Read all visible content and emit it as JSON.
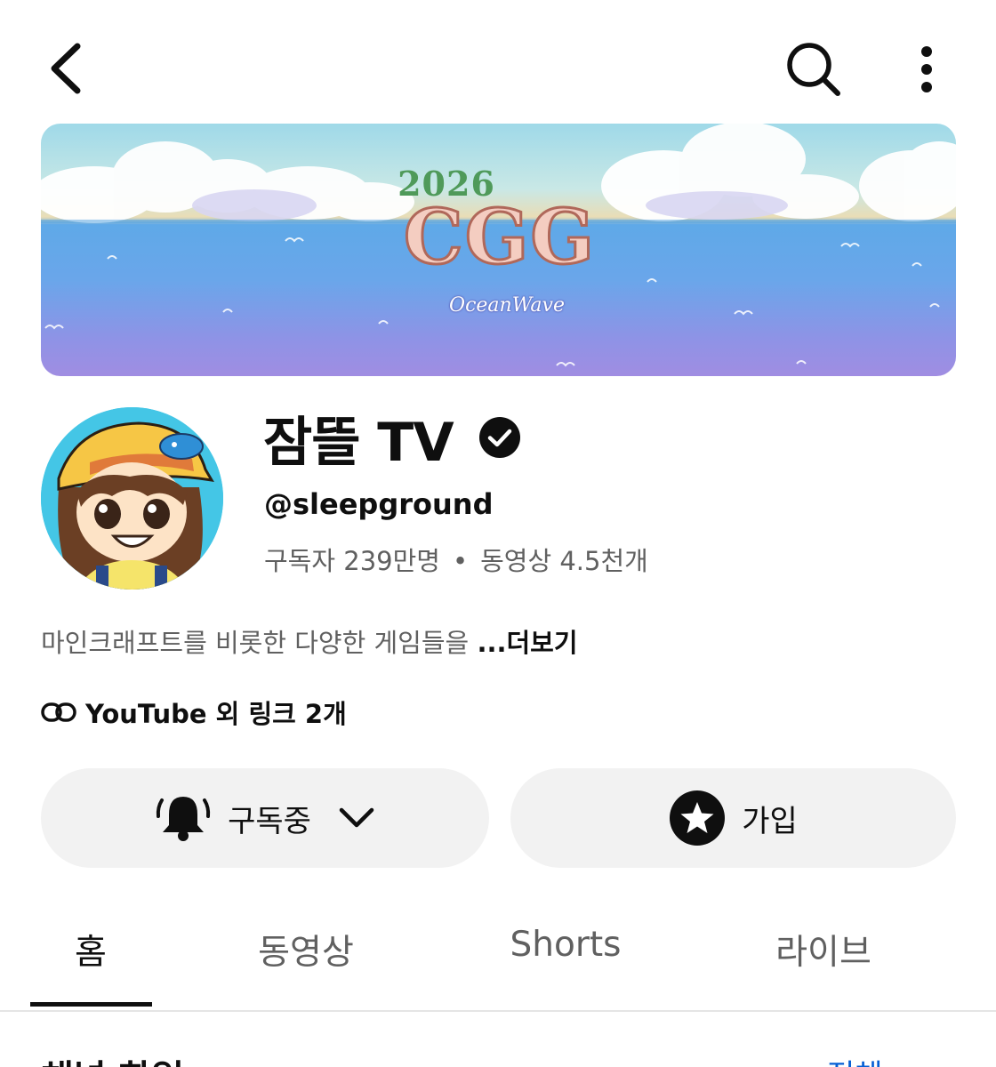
{
  "topbar": {
    "back_icon": "chevron-left-icon",
    "search_icon": "search-icon",
    "more_icon": "more-vertical-icon"
  },
  "banner": {
    "year": "2026",
    "logo": "CGG",
    "subtitle": "OceanWave"
  },
  "channel": {
    "name": "잠뜰 TV",
    "verified_icon": "verified-check-icon",
    "handle": "@sleepground",
    "subscribers": "구독자 239만명",
    "separator": "•",
    "videos": "동영상 4.5천개",
    "description": "마인크래프트를 비롯한 다양한 게임들을",
    "more_label": "...더보기",
    "links_label": "YouTube 외 링크 2개"
  },
  "buttons": {
    "subscribe_label": "구독중",
    "subscribe_icon": "bell-icon",
    "join_label": "가입",
    "join_icon": "star-badge-icon"
  },
  "tabs": [
    {
      "label": "홈",
      "active": true
    },
    {
      "label": "동영상",
      "active": false
    },
    {
      "label": "Shorts",
      "active": false
    },
    {
      "label": "라이브",
      "active": false
    }
  ],
  "next_section": {
    "title": "채널 화일",
    "link": "전체"
  },
  "colors": {
    "text_primary": "#0f0f0f",
    "text_secondary": "#606060",
    "pill_bg": "#f2f2f2",
    "link_blue": "#065fd4"
  }
}
